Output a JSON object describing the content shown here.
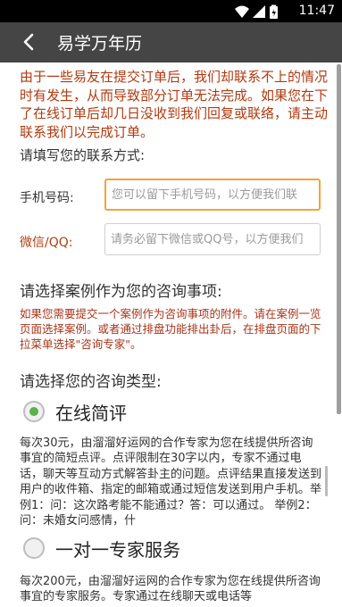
{
  "status_bar": {
    "time": "11:47"
  },
  "app_bar": {
    "title": "易学万年历"
  },
  "notice": "由于一些易友在提交订单后，我们却联系不上的情况时有发生，从而导致部分订单无法完成。如果您在下了在线订单后却几日没收到我们回复或联络，请主动联系我们以完成订单。",
  "contact_prompt": "请填写您的联系方式:",
  "phone": {
    "label": "手机号码:",
    "value": "",
    "placeholder": "您可以留下手机号码，以方便我们联"
  },
  "wechat": {
    "label": "微信/QQ:",
    "value": "",
    "placeholder": "请务必留下微信或QQ号，以方便我们"
  },
  "case_section": {
    "title": "请选择案例作为您的咨询事项:",
    "hint": "如果您需要提交一个案例作为咨询事项的附件。请在案例一览页面选择案例。或者通过排盘功能排出卦后，在排盘页面的下拉菜单选择\"咨询专家\"。"
  },
  "type_section": {
    "title": "请选择您的咨询类型:"
  },
  "options": [
    {
      "label": "在线简评",
      "selected": true,
      "description": "每次30元，由溜溜好运网的合作专家为您在线提供所咨询事宜的简短点评。点评限制在30字以内，专家不通过电话，聊天等互动方式解答卦主的问题。点评结果直接发送到用户的收件箱、指定的邮箱或通过短信发送到用户手机。举例1：问：这次路考能不能通过？答：可以通过。  举例2：问：未婚女问感情，什"
    },
    {
      "label": "一对一专家服务",
      "selected": false,
      "description": "每次200元，由溜溜好运网的合作专家为您在线提供所咨询事宜的专家服务。专家通过在线聊天或电话等"
    }
  ]
}
